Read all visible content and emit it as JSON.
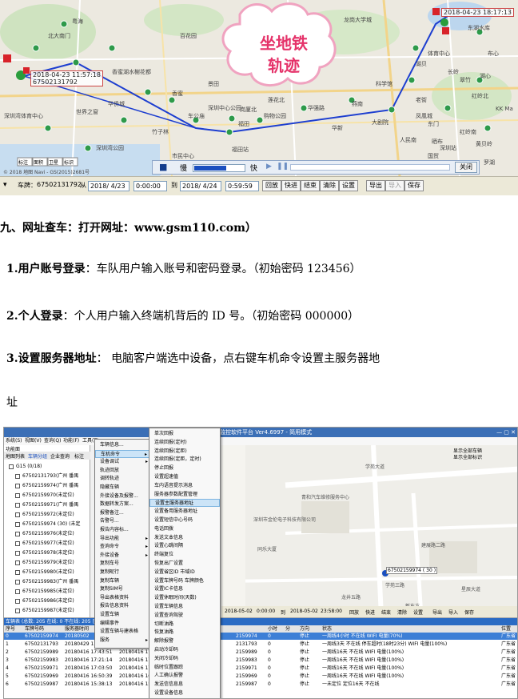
{
  "screenshot1": {
    "map_labels": [
      "北大南门",
      "粤海",
      "深圳湾体育中心",
      "香蜜湖水榭花都",
      "华侨城",
      "世界之窗",
      "深圳湾公园",
      "百花园",
      "竹子林",
      "车公庙",
      "福田",
      "景田",
      "香蜜",
      "莲花北",
      "深圳中心公园",
      "岗厦北",
      "购物公园",
      "福田站",
      "市民中心",
      "华强路",
      "华新",
      "燕南",
      "大剧院",
      "老街",
      "黄贝岭",
      "国贸",
      "湖贝",
      "体育中心",
      "红岭南",
      "科学馆",
      "东门",
      "人民南",
      "东湖水库",
      "翠竹",
      "布心",
      "红岭北",
      "长岭",
      "晒布",
      "湖心",
      "凤凰城",
      "深圳站",
      "罗湖",
      "KK Ma",
      "龙岗大学城"
    ],
    "pins": [
      {
        "label": "2018-04-23 11:57:18",
        "sub": "67502131792"
      },
      {
        "label": "2018-04-23 18:17:13",
        "sub": ""
      }
    ],
    "callout": {
      "line1": "坐地铁",
      "line2": "轨迹"
    },
    "playbar": {
      "slow": "慢",
      "fast": "快",
      "close": "关闭"
    },
    "copyright": "© 2018 地图 Navi - GS(2015)2681号",
    "map_buttons": [
      "标注",
      "面积",
      "卫星",
      "标识"
    ],
    "toolbar": {
      "car_label": "车牌：",
      "car_value": "67502131792",
      "from_label": "从",
      "from_date": "2018/ 4/23",
      "from_time": "0:00:00",
      "to_label": "到",
      "to_date": "2018/ 4/24",
      "to_time": "0:59:59",
      "buttons": [
        "回放",
        "快进",
        "结束",
        "清除",
        "设置",
        "导出",
        "导入",
        "保存"
      ]
    },
    "colors": {
      "route": "#1e3fd0",
      "callout_text": "#e5336a"
    }
  },
  "document": {
    "heading": "九、网址查车：打开网址：www.gsm110.com）",
    "item1_bold": "1.用户账号登录",
    "item1_text": "：车队用户输入账号和密码登录。（初始密码 123456）",
    "item2_bold": "2.个人登录",
    "item2_text": "：个人用户输入终端机背后的 ID 号。（初始密码 000000）",
    "item3_bold": "3.设置服务器地址",
    "item3_text": "：  电脑客户端选中设备，点右键车机命令设置主服务器地",
    "item3_cont": "址"
  },
  "screenshot2": {
    "title": "监控软件平台 Ver4.6997 - 简用模式",
    "menubar": [
      "系统(S)",
      "视图(V)",
      "查询(Q)",
      "功能(F)",
      "工具(T)"
    ],
    "left_tabs": [
      "地图列表",
      "车辆分组",
      "企业查询",
      "标注"
    ],
    "left_header": "功能面",
    "tree_group": "G15 (0/18)",
    "tree_items": [
      "67502131793(广州 番禺",
      "67502159974(广州 番禺",
      "67502159970(未定位)",
      "67502159971(广州 番禺",
      "67502159972(未定位)",
      "67502159974 (30) (未定",
      "67502159976(未定位)",
      "67502159977(未定位)",
      "67502159978(未定位)",
      "67502159979(未定位)",
      "67502159980(未定位)",
      "67502159983(广州 番禺",
      "67502159985(未定位)",
      "67502159986(未定位)",
      "67502159987(未定位)"
    ],
    "menu_a": [
      "车辆信息...",
      "车机命令",
      "设备调试",
      "轨迹回放",
      "调转轨迹",
      "隐藏车辆",
      "外接设备及报警...",
      "数据转发方案...",
      "报警备注...",
      "告警号...",
      "报告内容标...",
      "导出功能",
      "查询命令",
      "外接设备",
      "复制车号",
      "复制昵行",
      "复制车辆",
      "复制SIM号",
      "导出表格资料",
      "报告信息资料",
      "设置车辆",
      "编辑事件",
      "设置车辆与建表格",
      "服务"
    ],
    "menu_a_arrows": [
      1,
      2,
      11,
      12,
      13,
      23
    ],
    "menu_a_highlight": 1,
    "menu_b": [
      "单次回报",
      "连续回报(定时)",
      "连续回报(定距)",
      "连续回报(定距，定时)",
      "停止回报",
      "设置超速值",
      "车内语音提示消息",
      "服务器参数配置管理",
      "设置主服务器地址",
      "设置备用服务器地址",
      "设置短信中心号码",
      "电话回拨",
      "发送文本信息",
      "设置心跳间隔",
      "终端复位",
      "恢复出厂设置",
      "设置省区ID 市域ID",
      "设置车牌号码 车牌颜色",
      "设置IC卡信息",
      "设置休眠时间(天数)",
      "设置车辆信息",
      "设置查询驾驶",
      "切断油路",
      "恢复油路",
      "解除报警",
      "启动冷却码",
      "关闭冷却码",
      "临时位置跟踪",
      "人工确认报警",
      "发送信信息息",
      "设置设备信息"
    ],
    "menu_b_highlight": 8,
    "map_labels": [
      "学苑大道",
      "青和汽车维修服务中心",
      "深圳市金伦电子科技有限公司",
      "同乐大厦",
      "新东方",
      "学苑三路",
      "建展路二路",
      "星辰大道",
      "龙井五路"
    ],
    "map_tag": "67502159974 ( 30 )",
    "map_checkbox": [
      "显示全部车辆",
      "显示全部标识"
    ],
    "timebar": {
      "from_date": "2018-05-02",
      "from_time": "0:00:00",
      "to": "到",
      "to_date": "2018-05-02",
      "to_time": "23:58:00",
      "buttons": [
        "回放",
        "快进",
        "结束",
        "清除",
        "设置",
        "导出",
        "导入",
        "保存"
      ]
    },
    "grid_caption": "车辆表  (总数: 205 在线: 0 不在线: 205 已定位总数:207 定位率:100.0%)",
    "grid_headers": [
      "序号",
      "车牌号码",
      "服务器时间",
      "",
      "",
      "小时",
      "分",
      "方向",
      "状态",
      "位置"
    ],
    "grid_rows": [
      [
        "0",
        "67502159974",
        "20180502",
        "",
        "2159974",
        "0",
        "停止",
        "一周线4小时 不在线 WIFI 电量(70%)",
        "广东省"
      ],
      [
        "1",
        "67502131793",
        "20180429 11:30:59",
        "20180429 11:3",
        "2131793",
        "0",
        "停止",
        "一周线3天 不在线 停车超时(18时23分) WIFI 电量(100%)",
        "广东省"
      ],
      [
        "2",
        "67502159989",
        "20180416 17:43:51",
        "20180416 17:4",
        "2159989",
        "0",
        "停止",
        "一周线16天 不在线 WIFI 电量(100%)",
        "广东省"
      ],
      [
        "3",
        "67502159983",
        "20180416 17:21:14",
        "20180416 17:4",
        "2159983",
        "0",
        "停止",
        "一周线16天 不在线 WIFI 电量(100%)",
        "广东省"
      ],
      [
        "4",
        "67502159971",
        "20180416 17:03:50",
        "20180416 17:0",
        "2159971",
        "0",
        "停止",
        "一周线16天 不在线 WIFI 电量(100%)",
        "广东省"
      ],
      [
        "5",
        "67502159969",
        "20180416 16:50:39",
        "20180416 16:5",
        "2159969",
        "0",
        "停止",
        "一周线16天 不在线 WIFI 电量(100%)",
        "广东省"
      ],
      [
        "6",
        "67502159987",
        "20180416 15:38:13",
        "20180416 15:3",
        "2159987",
        "0",
        "停止",
        "一未定位 定位16天 不在线",
        "广东省"
      ]
    ]
  }
}
